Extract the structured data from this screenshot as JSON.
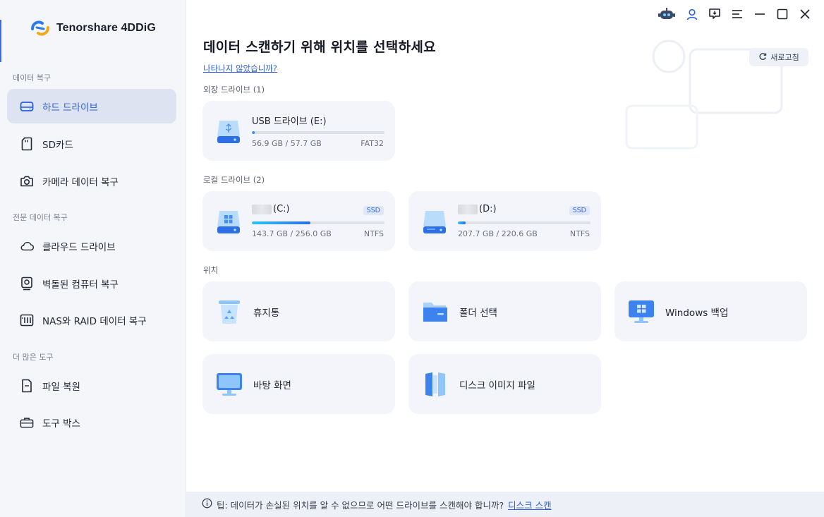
{
  "app": {
    "name": "Tenorshare 4DDiG"
  },
  "sidebar": {
    "sections": [
      {
        "title": "데이터 복구"
      },
      {
        "title": "전문 데이터 복구"
      },
      {
        "title": "더 많은 도구"
      }
    ],
    "items": [
      {
        "label": "하드 드라이브",
        "icon": "hard-drive-icon",
        "active": true
      },
      {
        "label": "SD카드",
        "icon": "sd-card-icon"
      },
      {
        "label": "카메라 데이터 복구",
        "icon": "camera-icon"
      },
      {
        "label": "클라우드 드라이브",
        "icon": "cloud-icon"
      },
      {
        "label": "벽돌된 컴퓨터 복구",
        "icon": "bricked-pc-icon"
      },
      {
        "label": "NAS와 RAID 데이터 복구",
        "icon": "nas-raid-icon"
      },
      {
        "label": "파일 복원",
        "icon": "file-icon"
      },
      {
        "label": "도구 박스",
        "icon": "toolbox-icon"
      }
    ]
  },
  "main": {
    "title": "데이터 스캔하기 위해 위치를 선택하세요",
    "not_shown_link": "나타나지 않았습니까?",
    "refresh_label": "새로고침",
    "external": {
      "title": "외장 드라이브 (1)",
      "drives": [
        {
          "name": "USB 드라이브 (E:)",
          "used": "56.9 GB / 57.7 GB",
          "fs": "FAT32",
          "fill_pct": 2
        }
      ]
    },
    "local": {
      "title": "로컬 드라이브 (2)",
      "drives": [
        {
          "name": "(C:)",
          "badge": "SSD",
          "used": "143.7 GB / 256.0 GB",
          "fs": "NTFS",
          "fill_pct": 44
        },
        {
          "name": "(D:)",
          "badge": "SSD",
          "used": "207.7 GB / 220.6 GB",
          "fs": "NTFS",
          "fill_pct": 6
        }
      ]
    },
    "locations": {
      "title": "위치",
      "items": [
        {
          "label": "휴지통",
          "icon": "recycle-bin-icon"
        },
        {
          "label": "폴더 선택",
          "icon": "folder-icon"
        },
        {
          "label": "Windows 백업",
          "icon": "windows-backup-icon"
        },
        {
          "label": "바탕 화면",
          "icon": "desktop-icon"
        },
        {
          "label": "디스크 이미지 파일",
          "icon": "disk-image-icon"
        }
      ]
    },
    "tip": {
      "text": "팁: 데이터가 손실된 위치를 알 수 없으므로 어떤 드라이브를 스캔해야 합니까?",
      "link": "디스크 스캔"
    }
  },
  "colors": {
    "accent": "#2b5fe0",
    "sidebar_bg": "#f5f6fa",
    "card_bg": "#f3f5fa"
  }
}
